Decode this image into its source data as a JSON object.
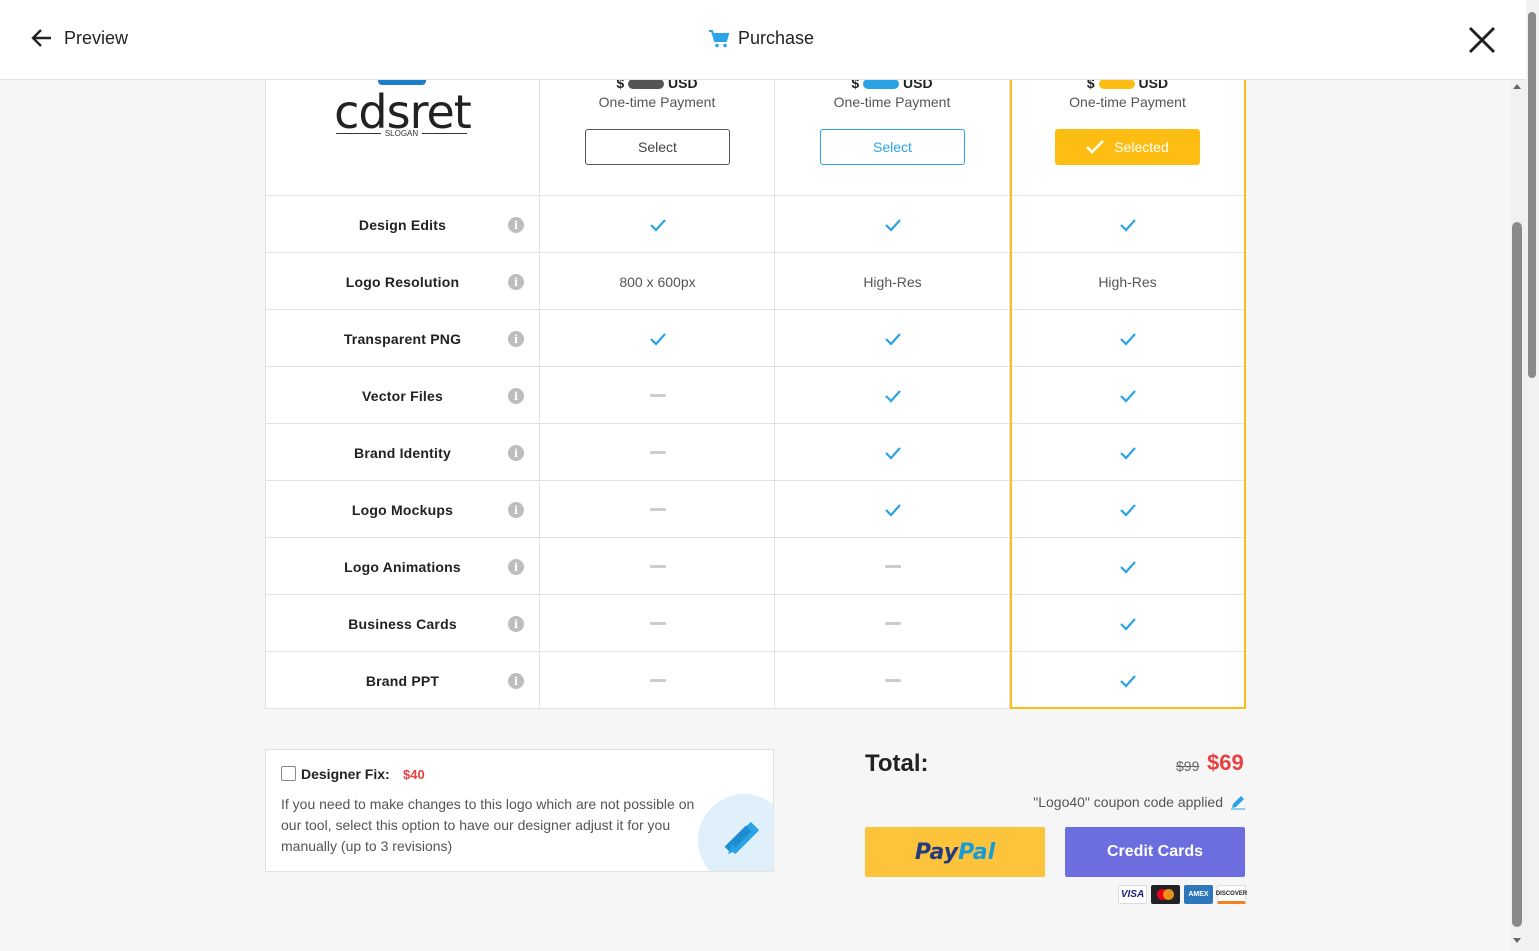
{
  "header": {
    "back_label": "Preview",
    "title": "Purchase"
  },
  "logo": {
    "text": "cdsret",
    "slogan": "SLOGAN"
  },
  "plans": [
    {
      "price_prefix": "$",
      "currency": "USD",
      "payment": "One-time Payment",
      "button": "Select",
      "selected": false
    },
    {
      "price_prefix": "$",
      "currency": "USD",
      "payment": "One-time Payment",
      "button": "Select",
      "selected": false
    },
    {
      "price_prefix": "$",
      "currency": "USD",
      "payment": "One-time Payment",
      "button": "Selected",
      "selected": true
    }
  ],
  "features": [
    {
      "name": "Design Edits",
      "values": [
        "check",
        "check",
        "check"
      ]
    },
    {
      "name": "Logo Resolution",
      "values": [
        "800 x 600px",
        "High-Res",
        "High-Res"
      ]
    },
    {
      "name": "Transparent PNG",
      "values": [
        "check",
        "check",
        "check"
      ]
    },
    {
      "name": "Vector Files",
      "values": [
        "dash",
        "check",
        "check"
      ]
    },
    {
      "name": "Brand Identity",
      "values": [
        "dash",
        "check",
        "check"
      ]
    },
    {
      "name": "Logo Mockups",
      "values": [
        "dash",
        "check",
        "check"
      ]
    },
    {
      "name": "Logo Animations",
      "values": [
        "dash",
        "dash",
        "check"
      ]
    },
    {
      "name": "Business Cards",
      "values": [
        "dash",
        "dash",
        "check"
      ]
    },
    {
      "name": "Brand PPT",
      "values": [
        "dash",
        "dash",
        "check"
      ]
    }
  ],
  "designer_fix": {
    "label": "Designer Fix:",
    "price": "$40",
    "description": "If you need to make changes to this logo which are not possible on our tool, select this option to have our designer adjust it for you manually (up to 3 revisions)",
    "checked": false
  },
  "total": {
    "label": "Total:",
    "old_price": "$99",
    "new_price": "$69",
    "coupon": "\"Logo40\" coupon code applied"
  },
  "payment": {
    "paypal_part1": "Pay",
    "paypal_part2": "Pal",
    "cards_label": "Credit Cards",
    "card_brands": [
      "VISA",
      "",
      "AMEX",
      "DISCOVER"
    ]
  },
  "colors": {
    "accent_blue": "#29a3e6",
    "selected_yellow": "#fdbd12",
    "price_red": "#e83f3f",
    "cards_purple": "#6c6ee0"
  },
  "icons": {
    "back": "arrow-left-icon",
    "cart": "cart-icon",
    "close": "close-icon",
    "info": "info-icon",
    "check": "check-icon",
    "edit": "pencil-icon"
  }
}
